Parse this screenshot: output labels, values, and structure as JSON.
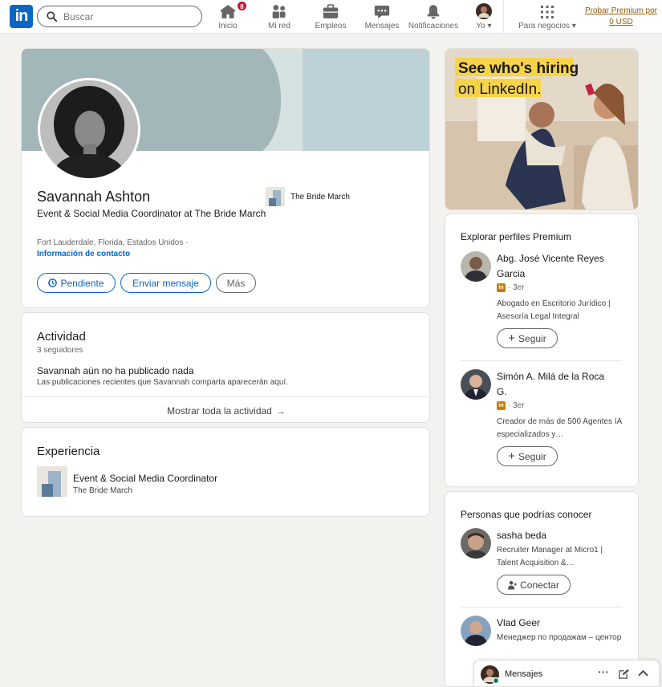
{
  "nav": {
    "search_placeholder": "Buscar",
    "items": [
      {
        "label": "Inicio",
        "icon": "home-icon",
        "badge": "8"
      },
      {
        "label": "Mi red",
        "icon": "network-icon"
      },
      {
        "label": "Empleos",
        "icon": "briefcase-icon"
      },
      {
        "label": "Mensajes",
        "icon": "messaging-icon"
      },
      {
        "label": "Notificaciones",
        "icon": "bell-icon"
      },
      {
        "label": "Yo",
        "icon": "me-avatar"
      }
    ],
    "business_label": "Para negocios",
    "premium_link": "Probar Premium por 0 USD"
  },
  "profile": {
    "name": "Savannah Ashton",
    "headline": "Event & Social Media Coordinator at The Bride March",
    "location": "Fort Lauderdale, Florida, Estados Unidos ·",
    "contact_info": "Información de contacto",
    "current_company": "The Bride March",
    "buttons": {
      "pending": "Pendiente",
      "message": "Enviar mensaje",
      "more": "Más"
    }
  },
  "activity": {
    "title": "Actividad",
    "followers": "3 seguidores",
    "empty_title": "Savannah aún no ha publicado nada",
    "empty_desc": "Las publicaciones recientes que Savannah comparta aparecerán aquí.",
    "show_all": "Mostrar toda la actividad"
  },
  "experience": {
    "title": "Experiencia",
    "items": [
      {
        "role": "Event & Social Media Coordinator",
        "company": "The Bride March"
      }
    ]
  },
  "ad": {
    "line1": "See who's hiring",
    "line2": "on LinkedIn."
  },
  "premium_profiles": {
    "title": "Explorar perfiles Premium",
    "people": [
      {
        "name": "Abg. José Vicente Reyes Garcia",
        "degree": "· 3er",
        "desc": "Abogado en Escritorio Jurídico | Asesoría Legal Integral",
        "action": "Seguir"
      },
      {
        "name": "Simón A. Milá de la Roca G.",
        "degree": "· 3er",
        "desc": "Creador de más de 500 Agentes IA especializados y…",
        "action": "Seguir"
      }
    ]
  },
  "people_you_may_know": {
    "title": "Personas que podrías conocer",
    "people": [
      {
        "name": "sasha beda",
        "desc": "Recruiter Manager at Micro1 | Talent Acquisition &…",
        "action": "Conectar"
      },
      {
        "name": "Vlad Geer",
        "desc": "Менеджер по продажам – центор"
      }
    ]
  },
  "messaging": {
    "label": "Mensajes"
  }
}
